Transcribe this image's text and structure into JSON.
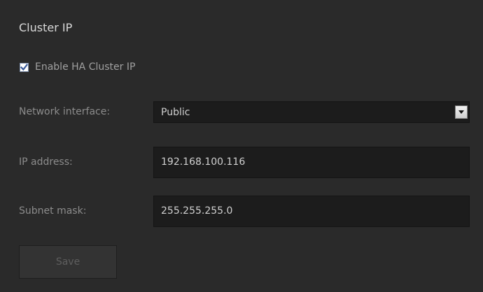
{
  "section": {
    "title": "Cluster IP"
  },
  "enable_ha": {
    "label": "Enable HA Cluster IP",
    "checked": true
  },
  "network_interface": {
    "label": "Network interface:",
    "value": "Public"
  },
  "ip_address": {
    "label": "IP address:",
    "value": "192.168.100.116"
  },
  "subnet_mask": {
    "label": "Subnet mask:",
    "value": "255.255.255.0"
  },
  "save_button": {
    "label": "Save",
    "enabled": false
  },
  "icons": {
    "checkbox_check": "check-icon",
    "dropdown_arrow": "triangle-down-icon"
  },
  "colors": {
    "background": "#2a2a2a",
    "input_background": "#1c1c1c",
    "checkbox_accent": "#3a5a9a"
  }
}
